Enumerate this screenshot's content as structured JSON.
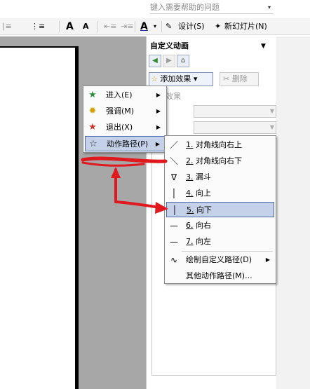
{
  "help": {
    "placeholder": "键入需要帮助的问题",
    "arrow": "▾"
  },
  "toolbar": {
    "indent_icon": "∣≡",
    "bullets_icon": "⋮≡",
    "grow_font": "A",
    "shrink_font": "A",
    "font_color": "A",
    "design_label": "设计(S)",
    "new_slide_label": "新幻灯片(N)"
  },
  "pane": {
    "title": "自定义动画",
    "title_arrow": "▼",
    "add_effect": "添加效果",
    "add_arrow": "▾",
    "delete": "删除",
    "effect_label": "效果"
  },
  "menu1": {
    "items": [
      {
        "label": "进入(E)",
        "icon": "star-green-icon",
        "glyph": "★",
        "color": "#2e8b3a"
      },
      {
        "label": "强调(M)",
        "icon": "star-yellow-icon",
        "glyph": "✹",
        "color": "#d4a000"
      },
      {
        "label": "退出(X)",
        "icon": "star-red-icon",
        "glyph": "★",
        "color": "#c0392b"
      },
      {
        "label": "动作路径(P)",
        "icon": "star-outline-icon",
        "glyph": "☆",
        "color": "#333333"
      }
    ]
  },
  "menu2": {
    "items": [
      {
        "num": "1.",
        "label": "对角线向右上",
        "icon": "diagonal-up-right-icon"
      },
      {
        "num": "2.",
        "label": "对角线向右下",
        "icon": "diagonal-down-right-icon"
      },
      {
        "num": "3.",
        "label": "漏斗",
        "icon": "funnel-icon"
      },
      {
        "num": "4.",
        "label": "向上",
        "icon": "path-up-icon"
      },
      {
        "num": "5.",
        "label": "向下",
        "icon": "path-down-icon"
      },
      {
        "num": "6.",
        "label": "向右",
        "icon": "path-right-icon"
      },
      {
        "num": "7.",
        "label": "向左",
        "icon": "path-left-icon"
      }
    ],
    "draw_custom": "绘制自定义路径(D)",
    "more": "其他动作路径(M)..."
  },
  "colors": {
    "highlight": "#c4d1e9",
    "highlight_border": "#4a6bb0",
    "annotation": "#e0191f"
  }
}
